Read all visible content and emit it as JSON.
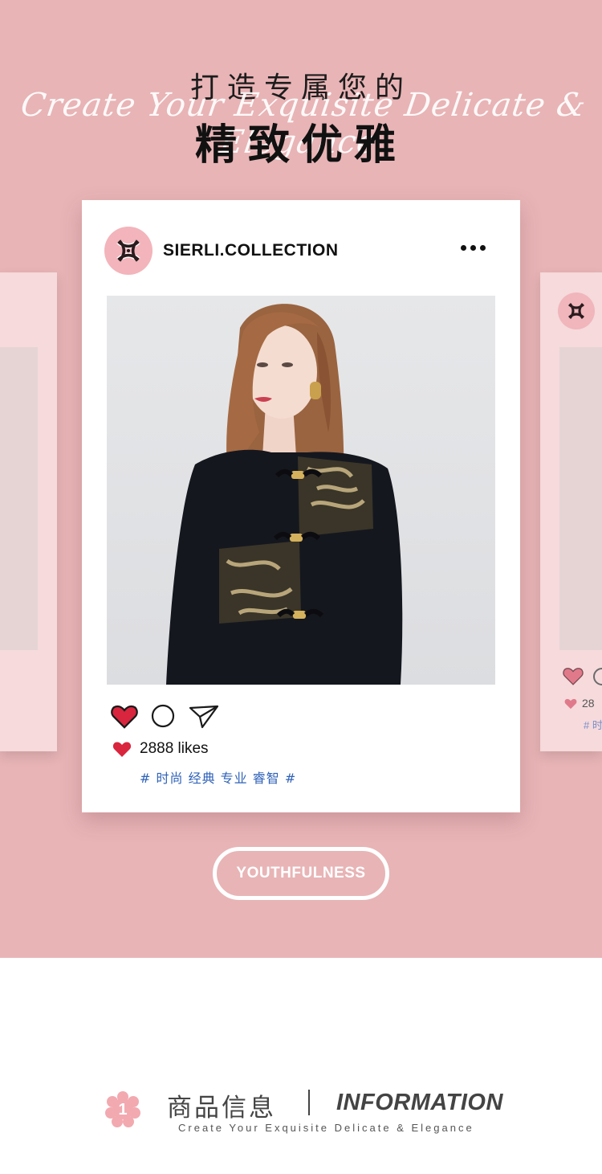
{
  "colors": {
    "hero_bg": "#e8b4b6",
    "card_bg": "#ffffff",
    "side_card_bg": "#f6dadc",
    "avatar_bg": "#f3b4bb",
    "heart_red": "#d9253d",
    "tag_blue": "#2f62b8",
    "dress_black": "#15171f"
  },
  "hero": {
    "title_line1": "打造专属您的",
    "script_line": "Create Your Exquisite Delicate & Elegance",
    "title_line2": "精致优雅"
  },
  "post": {
    "account_name": "SIERLI.COLLECTION",
    "avatar_icon": "brand-monogram-icon",
    "more_icon": "more-dots-icon",
    "image_alt": "model wearing black jacquard dress",
    "actions": [
      {
        "name": "like-heart-icon"
      },
      {
        "name": "comment-icon"
      },
      {
        "name": "share-send-icon"
      }
    ],
    "likes_text": "2888 likes",
    "tags": "# 时尚 经典 专业 睿智 #"
  },
  "side_cards": {
    "right_likes_partial": "28",
    "right_tags_partial": "# 时"
  },
  "badge": {
    "label": "YOUTHFULNESS"
  },
  "info_section": {
    "number": "1",
    "title_cn": "商品信息",
    "title_en": "INFORMATION",
    "subtitle": "Create Your Exquisite Delicate & Elegance"
  }
}
